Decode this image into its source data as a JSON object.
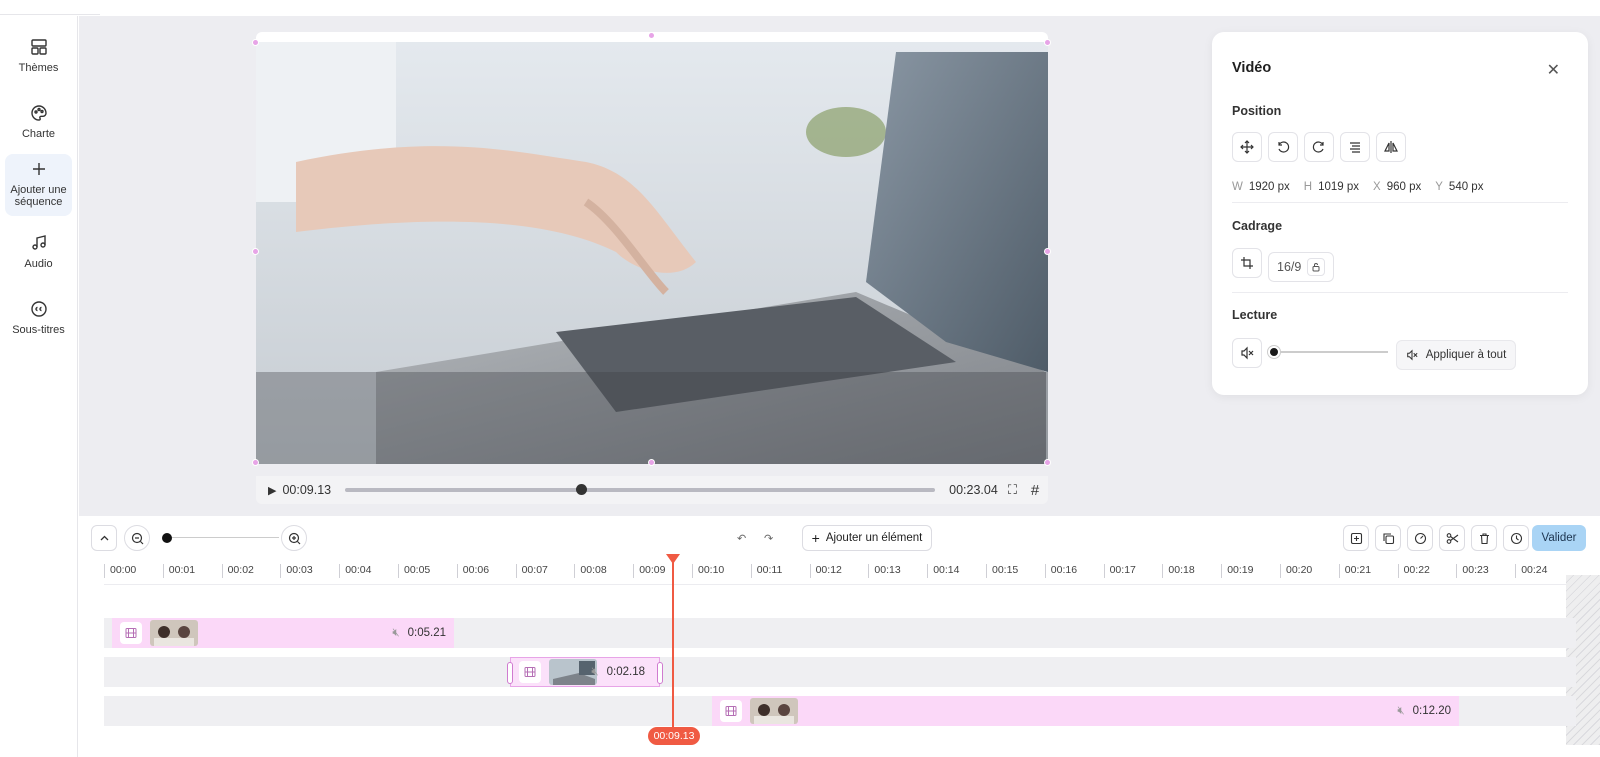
{
  "sidebar": {
    "items": [
      {
        "label": "Thèmes",
        "icon": "layout-icon"
      },
      {
        "label": "Charte",
        "icon": "palette-icon"
      },
      {
        "label": "Ajouter une séquence",
        "icon": "plus-icon",
        "active": true
      },
      {
        "label": "Audio",
        "icon": "music-note-icon"
      },
      {
        "label": "Sous-titres",
        "icon": "closed-captions-icon"
      }
    ]
  },
  "player": {
    "current_time": "00:09.13",
    "total_time": "00:23.04",
    "progress_fraction": 0.4
  },
  "panel": {
    "title": "Vidéo",
    "position_title": "Position",
    "dims": {
      "w_label": "W",
      "w_value": "1920 px",
      "h_label": "H",
      "h_value": "1019 px",
      "x_label": "X",
      "x_value": "960 px",
      "y_label": "Y",
      "y_value": "540 px"
    },
    "crop_title": "Cadrage",
    "ratio": "16/9",
    "playback_title": "Lecture",
    "apply_all": "Appliquer à tout"
  },
  "toolbar": {
    "add_element": "Ajouter un élément",
    "validate": "Valider"
  },
  "timeline": {
    "ticks": [
      "00:00",
      "00:01",
      "00:02",
      "00:03",
      "00:04",
      "00:05",
      "00:06",
      "00:07",
      "00:08",
      "00:09",
      "00:10",
      "00:11",
      "00:12",
      "00:13",
      "00:14",
      "00:15",
      "00:16",
      "00:17",
      "00:18",
      "00:19",
      "00:20",
      "00:21",
      "00:22",
      "00:23",
      "00:24"
    ],
    "clips": [
      {
        "duration": "0:05.21"
      },
      {
        "duration": "0:02.18"
      },
      {
        "duration": "0:12.20"
      }
    ],
    "playhead_time": "00:09.13"
  },
  "colors": {
    "accent": "#f05a43",
    "clip": "#fbd8f8",
    "validate": "#a9d4f5"
  }
}
